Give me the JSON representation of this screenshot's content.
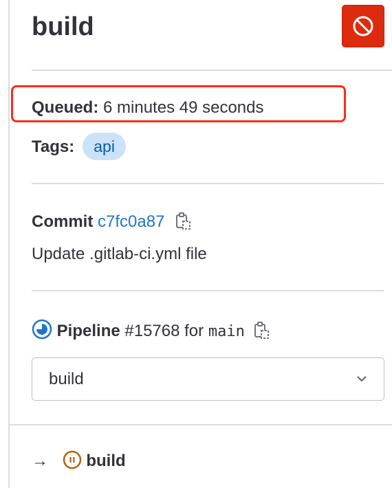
{
  "job": {
    "title": "build",
    "cancel_icon": "cancel-icon",
    "cancel_color": "#dd2b0e"
  },
  "queued": {
    "label": "Queued:",
    "value": "6 minutes 49 seconds",
    "highlight_color": "#ff2a1a"
  },
  "tags": {
    "label": "Tags:",
    "items": [
      "api"
    ]
  },
  "commit": {
    "label": "Commit",
    "sha": "c7fc0a87",
    "message": "Update .gitlab-ci.yml file"
  },
  "pipeline": {
    "label": "Pipeline",
    "number": "#15768",
    "for_text": "for",
    "branch": "main",
    "status": "running"
  },
  "stage_select": {
    "value": "build"
  },
  "jobs": [
    {
      "arrow": "→",
      "name": "build",
      "status": "manual-paused"
    }
  ]
}
